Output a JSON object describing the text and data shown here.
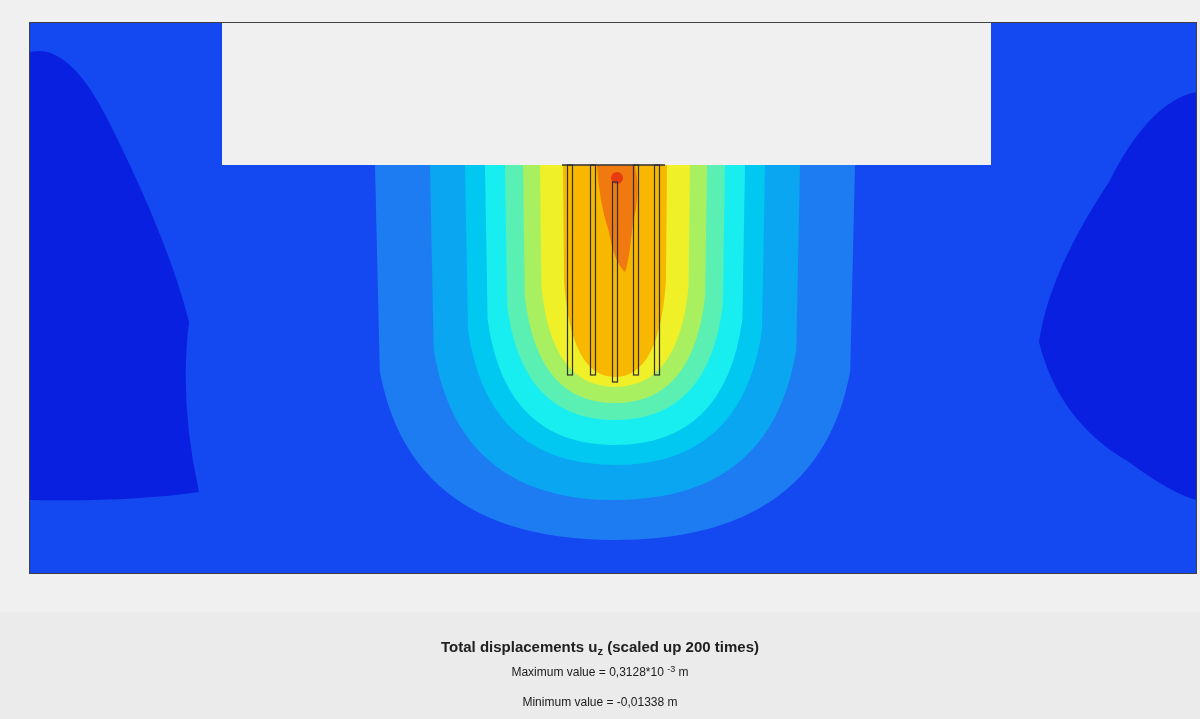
{
  "plot": {
    "title": "Total displacements u$_{z}$ (scaled up 200 times)",
    "max_value": "Maximum value = 0,3128*10 $^{-3}$ m",
    "min_value": "Minimum value = -0,01338 m"
  }
}
